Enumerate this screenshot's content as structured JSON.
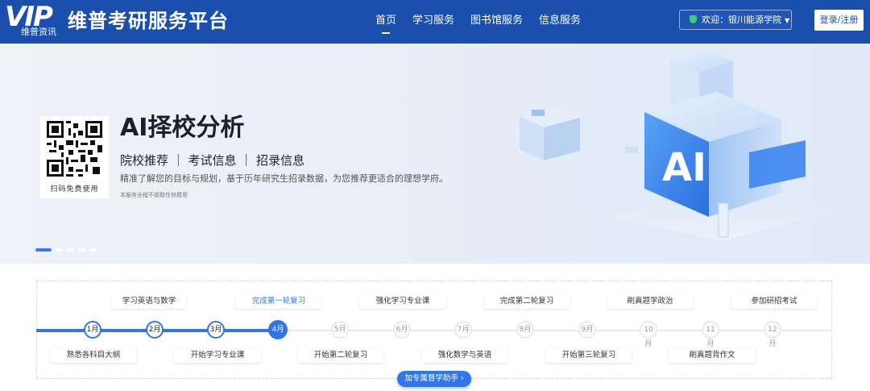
{
  "header": {
    "logo_text": "VIP",
    "logo_sub": "维普资讯",
    "brand": "维普考研服务平台",
    "nav": [
      "首页",
      "学习服务",
      "图书馆服务",
      "信息服务"
    ],
    "welcome": "欢迎：银川能源学院",
    "login": "登录/注册"
  },
  "banner": {
    "qr_caption": "扫码免费使用",
    "title": "AI择校分析",
    "tags": "院校推荐 ｜ 考试信息 ｜ 招录信息",
    "description": "精准了解您的目标与规划，基于历年研究生招录数据，为您推荐更适合的理想学府。",
    "note": "本服务全程不收取任何费用",
    "illustration_text": "AI"
  },
  "timeline": {
    "months": [
      "1月",
      "2月",
      "3月",
      "4月",
      "5月",
      "6月",
      "7月",
      "8月",
      "9月",
      "10月",
      "11月",
      "12月"
    ],
    "current_month": "4月",
    "top_labels": [
      "学习英语与数学",
      "完成第一轮复习",
      "强化学习专业课",
      "完成第二轮复习",
      "刷真题学政治",
      "参加研招考试"
    ],
    "bottom_labels": [
      "熟悉各科目大纲",
      "开始学习专业课",
      "开始第二轮复习",
      "强化数学与英语",
      "开始第三轮复习",
      "刷真题背作文"
    ],
    "assist_button": "加专属督学助手 ›"
  }
}
